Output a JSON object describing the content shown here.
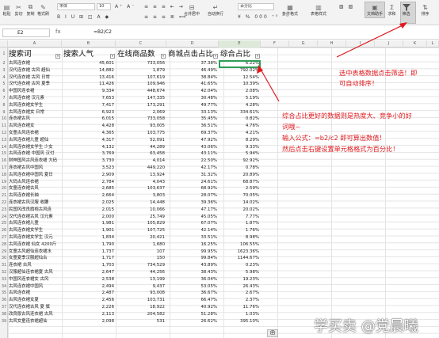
{
  "toolbar": {
    "paste": "粘贴",
    "cut": "剪切",
    "copy": "复制",
    "format_painter": "格式刷",
    "font_name": "宋体",
    "font_size": "10",
    "merge_center": "合并居中",
    "wrap_text": "自动换行",
    "number_format": "百分比",
    "conditional_format": "条件格式",
    "table_style": "表格样式",
    "doc_assistant": "文档助手",
    "sum": "求和",
    "filter": "筛选",
    "sort": "排序"
  },
  "formula_bar": {
    "cell_ref": "E2",
    "fx": "fx",
    "formula": "=B2/C2"
  },
  "columns": [
    "A",
    "B",
    "C",
    "D",
    "E",
    "F",
    "G",
    "H",
    "I",
    "J",
    "K",
    "L"
  ],
  "headers": {
    "a": "搜索词",
    "b": "搜索人气",
    "c": "在线商品数",
    "d": "商城点击占比",
    "e": "综合占比"
  },
  "rows": [
    {
      "n": "2",
      "a": "古风连衣裙",
      "b": "45,601",
      "c": "733,056",
      "d": "37.38%",
      "e": "6.22%"
    },
    {
      "n": "3",
      "a": "汉代连衣裙 古风 超仙",
      "b": "14,882",
      "c": "1,879",
      "d": "46.49%",
      "e": "792.02%"
    },
    {
      "n": "4",
      "a": "汉代连衣裙 古风 日常",
      "b": "13,416",
      "c": "107,619",
      "d": "38.84%",
      "e": "12.54%"
    },
    {
      "n": "5",
      "a": "汉代连衣裙 古风 夏季",
      "b": "11,426",
      "c": "109,946",
      "d": "41.65%",
      "e": "10.39%"
    },
    {
      "n": "6",
      "a": "中国风连衣裙",
      "b": "9,334",
      "c": "448,674",
      "d": "42.04%",
      "e": "2.08%"
    },
    {
      "n": "7",
      "a": "古风连衣裙 汉元素",
      "b": "7,653",
      "c": "147,335",
      "d": "30.48%",
      "e": "5.19%"
    },
    {
      "n": "8",
      "a": "古风连衣裙女学生",
      "b": "7,417",
      "c": "173,291",
      "d": "49.77%",
      "e": "4.28%"
    },
    {
      "n": "9",
      "a": "古风连衣裙女 日常",
      "b": "6,923",
      "c": "2,069",
      "d": "33.13%",
      "e": "334.61%"
    },
    {
      "n": "10",
      "a": "连衣裙古风",
      "b": "6,015",
      "c": "733,058",
      "d": "35.45%",
      "e": "0.82%"
    },
    {
      "n": "11",
      "a": "古风连衣裙女",
      "b": "4,428",
      "c": "93,005",
      "d": "36.51%",
      "e": "4.76%"
    },
    {
      "n": "12",
      "a": "女童古风连衣裙",
      "b": "4,365",
      "c": "103,775",
      "d": "69.37%",
      "e": "4.21%"
    },
    {
      "n": "13",
      "a": "古风连衣裙儿童 超仙",
      "b": "4,317",
      "c": "52,091",
      "d": "47.92%",
      "e": "8.29%"
    },
    {
      "n": "14",
      "a": "古风连衣裙女学生 少女",
      "b": "4,132",
      "c": "44,289",
      "d": "43.06%",
      "e": "9.33%"
    },
    {
      "n": "15",
      "a": "古风连衣裙 中国风 汉付",
      "b": "3,769",
      "c": "63,458",
      "d": "43.11%",
      "e": "5.94%"
    },
    {
      "n": "16",
      "a": "财神国风古风连衣裙 大码",
      "b": "3,730",
      "c": "4,014",
      "d": "22.50%",
      "e": "92.92%"
    },
    {
      "n": "17",
      "a": "连衣裙古风中国风",
      "b": "3,523",
      "c": "449,220",
      "d": "42.17%",
      "e": "0.78%"
    },
    {
      "n": "18",
      "a": "古风连衣裙中国风 夏日",
      "b": "2,909",
      "c": "13,924",
      "d": "31.32%",
      "e": "20.89%"
    },
    {
      "n": "19",
      "a": "大码古风连衣裙",
      "b": "2,784",
      "c": "4,043",
      "d": "24.61%",
      "e": "68.87%"
    },
    {
      "n": "20",
      "a": "女童连衣裙古风",
      "b": "2,685",
      "c": "103,637",
      "d": "68.92%",
      "e": "2.59%"
    },
    {
      "n": "21",
      "a": "古风连衣裙长袖",
      "b": "2,664",
      "c": "3,803",
      "d": "28.07%",
      "e": "70.05%"
    },
    {
      "n": "22",
      "a": "连衣裙古风汉服 收腰",
      "b": "2,025",
      "c": "14,448",
      "d": "39.36%",
      "e": "14.02%"
    },
    {
      "n": "23",
      "a": "民国风改良旗袍古风连",
      "b": "2,015",
      "c": "10,066",
      "d": "47.17%",
      "e": "20.02%"
    },
    {
      "n": "24",
      "a": "汉代连衣裙古风 汉元素",
      "b": "2,000",
      "c": "25,749",
      "d": "45.05%",
      "e": "7.77%"
    },
    {
      "n": "25",
      "a": "古风连衣裙儿童",
      "b": "1,981",
      "c": "105,829",
      "d": "67.07%",
      "e": "1.87%"
    },
    {
      "n": "26",
      "a": "古风连衣裙女学生",
      "b": "1,901",
      "c": "107,725",
      "d": "42.14%",
      "e": "1.76%"
    },
    {
      "n": "27",
      "a": "古风连衣裙女学生 汉元",
      "b": "1,834",
      "c": "20,421",
      "d": "33.51%",
      "e": "8.98%"
    },
    {
      "n": "28",
      "a": "古风连衣裙 仙女 4200斤",
      "b": "1,790",
      "c": "1,680",
      "d": "16.25%",
      "e": "106.55%"
    },
    {
      "n": "29",
      "a": "女童古风超仙连衣裙水",
      "b": "1,737",
      "c": "107",
      "d": "99.95%",
      "e": "1623.36%"
    },
    {
      "n": "30",
      "a": "女童夏季汉服超仙古",
      "b": "1,717",
      "c": "150",
      "d": "99.84%",
      "e": "1144.67%"
    },
    {
      "n": "31",
      "a": "连衣裙 古风",
      "b": "1,703",
      "c": "734,529",
      "d": "43.89%",
      "e": "0.23%"
    },
    {
      "n": "32",
      "a": "汉服超仙连衣裙夏 古风",
      "b": "2,647",
      "c": "44,256",
      "d": "38.43%",
      "e": "5.98%"
    },
    {
      "n": "33",
      "a": "中国风连衣裙女 古风",
      "b": "2,538",
      "c": "13,199",
      "d": "36.04%",
      "e": "19.23%"
    },
    {
      "n": "34",
      "a": "古风连衣裙中国风",
      "b": "2,494",
      "c": "9,437",
      "d": "53.05%",
      "e": "26.43%"
    },
    {
      "n": "35",
      "a": "古风连衣裙",
      "b": "2,487",
      "c": "93,008",
      "d": "36.67%",
      "e": "2.67%"
    },
    {
      "n": "36",
      "a": "古风连衣裙女夏",
      "b": "2,456",
      "c": "103,731",
      "d": "66.47%",
      "e": "2.37%"
    },
    {
      "n": "37",
      "a": "汉代连衣裙古风 夏 旗",
      "b": "2,226",
      "c": "18,922",
      "d": "40.92%",
      "e": "11.76%"
    },
    {
      "n": "38",
      "a": "改良版古风连衣裙 古风",
      "b": "2,113",
      "c": "204,582",
      "d": "51.28%",
      "e": "1.03%"
    },
    {
      "n": "39",
      "a": "古风女童连衣裙超仙",
      "b": "2,098",
      "c": "531",
      "d": "26.62%",
      "e": "395.10%"
    }
  ],
  "sheet_tab_fragment": "函",
  "annotations": {
    "top_right_1": "选中表格数据点击筛选！即",
    "top_right_2": "可自动排序！",
    "mid_1": "综合占比更好的数据则是热度大、竞争小的好",
    "mid_2": "词哦~",
    "mid_3": "输入公式：=b2/c2 即可算出数值！",
    "mid_4": "然后点击右键设置单元格格式为百分比！",
    "color": "#e0191e"
  },
  "watermark": "学买卖 @党晨曦"
}
